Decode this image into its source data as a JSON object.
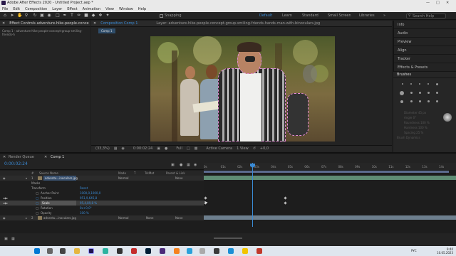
{
  "window": {
    "title": "Adobe After Effects 2020 - Untitled Project.aep *"
  },
  "menu": [
    "File",
    "Edit",
    "Composition",
    "Layer",
    "Effect",
    "Animation",
    "View",
    "Window",
    "Help"
  ],
  "toolbar": {
    "snapping": "Snapping",
    "workspaces": [
      "Default",
      "Learn",
      "Standard",
      "Small Screen",
      "Libraries"
    ],
    "active_workspace": "Default",
    "search_placeholder": "Search Help"
  },
  "left_panel": {
    "tab": "Effect Controls adventure-hike-people-conce",
    "subtitle": "Comp 1 - adventure-hike-people-concept-group-smiling-friends-h"
  },
  "comp_panel": {
    "tab": "Composition Comp 1",
    "layer_tab": "Layer: adventure-hike-people-concept-group-smiling-friends-hands-man-with-binoculars.jpg",
    "breadcrumb": "Comp 1"
  },
  "viewer_controls": {
    "zoom": "(33,3%)",
    "time": "0:00:02:24",
    "resolution": "Full",
    "camera": "Active Camera",
    "views": "1 View",
    "offset": "+0,0"
  },
  "right_panel": {
    "items": [
      "Info",
      "Audio",
      "Preview",
      "Align",
      "Tracker",
      "Effects & Presets"
    ],
    "brushes_title": "Brushes",
    "brush_props": [
      "Diameter 45 px",
      "Angle 0°",
      "Roundness 100 %",
      "Hardness 100 %",
      "Spacing 25 %",
      "Brush Dynamics"
    ]
  },
  "timeline": {
    "tabs": [
      "Render Queue",
      "Comp 1"
    ],
    "active_tab": "Comp 1",
    "timecode": "0:00:02:24",
    "ruler": [
      "0s",
      "01s",
      "02s",
      "03s",
      "04s",
      "05s",
      "06s",
      "07s",
      "08s",
      "09s",
      "10s",
      "11s",
      "12s",
      "13s",
      "14s"
    ],
    "columns": [
      "#",
      "Source Name",
      "Mode",
      "T",
      "TrkMat",
      "Parent & Link"
    ],
    "layers": [
      {
        "index": "1",
        "name": "adventu...inoculars.jpg",
        "mode": "Normal",
        "parent": "None"
      },
      {
        "index": "2",
        "name": "adventu...inoculars.jpg",
        "mode": "Normal",
        "trkmat": "None",
        "parent": "None"
      }
    ],
    "properties": [
      {
        "label": "Masks",
        "value": ""
      },
      {
        "label": "Transform",
        "value": "Reset"
      },
      {
        "label": "Anchor Point",
        "value": "1000,0,1000,0"
      },
      {
        "label": "Position",
        "value": "951,9,645,8"
      },
      {
        "label": "Scale",
        "value": "95,4,89,8 %"
      },
      {
        "label": "Rotation",
        "value": "0x+0,0°"
      },
      {
        "label": "Opacity",
        "value": "100 %"
      }
    ]
  },
  "taskbar": {
    "lang": "РУС",
    "time": "9:40",
    "date": "10.05.2023"
  }
}
